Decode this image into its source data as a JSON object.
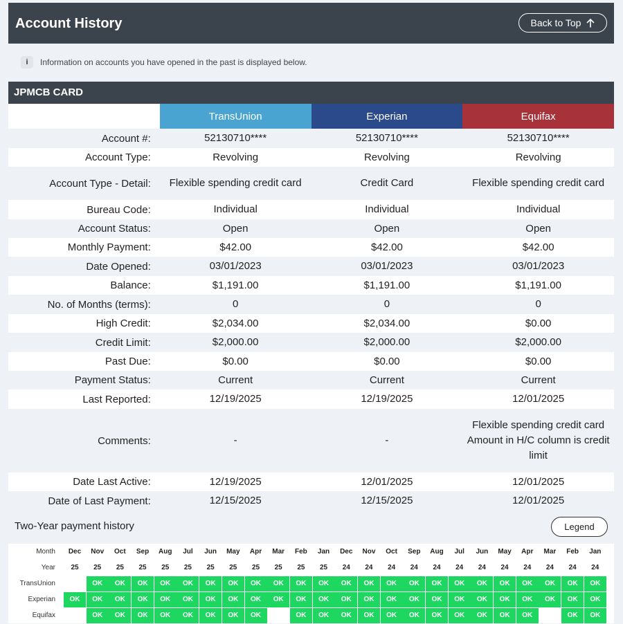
{
  "header": {
    "title": "Account History",
    "back_label": "Back to Top"
  },
  "info_text": "Information on accounts you have opened in the past is displayed below.",
  "account": {
    "name": "JPMCB CARD",
    "bureaus": [
      "TransUnion",
      "Experian",
      "Equifax"
    ],
    "rows": [
      {
        "label": "Account #:",
        "values": [
          "52130710****",
          "52130710****",
          "52130710****"
        ],
        "h": 28
      },
      {
        "label": "Account Type:",
        "values": [
          "Revolving",
          "Revolving",
          "Revolving"
        ],
        "h": 27
      },
      {
        "label": "Account Type - Detail:",
        "values": [
          "Flexible spending credit card",
          "Credit Card",
          "Flexible spending credit card"
        ],
        "h": 48
      },
      {
        "label": "Bureau Code:",
        "values": [
          "Individual",
          "Individual",
          "Individual"
        ],
        "h": 28
      },
      {
        "label": "Account Status:",
        "values": [
          "Open",
          "Open",
          "Open"
        ],
        "h": 27
      },
      {
        "label": "Monthly Payment:",
        "values": [
          "$42.00",
          "$42.00",
          "$42.00"
        ],
        "h": 27
      },
      {
        "label": "Date Opened:",
        "values": [
          "03/01/2023",
          "03/01/2023",
          "03/01/2023"
        ],
        "h": 28
      },
      {
        "label": "Balance:",
        "values": [
          "$1,191.00",
          "$1,191.00",
          "$1,191.00"
        ],
        "h": 27
      },
      {
        "label": "No. of Months (terms):",
        "values": [
          "0",
          "0",
          "0"
        ],
        "h": 28
      },
      {
        "label": "High Credit:",
        "values": [
          "$2,034.00",
          "$2,034.00",
          "$0.00"
        ],
        "h": 27
      },
      {
        "label": "Credit Limit:",
        "values": [
          "$2,000.00",
          "$2,000.00",
          "$2,000.00"
        ],
        "h": 28
      },
      {
        "label": "Past Due:",
        "values": [
          "$0.00",
          "$0.00",
          "$0.00"
        ],
        "h": 27
      },
      {
        "label": "Payment Status:",
        "values": [
          "Current",
          "Current",
          "Current"
        ],
        "h": 27
      },
      {
        "label": "Last Reported:",
        "values": [
          "12/19/2025",
          "12/19/2025",
          "12/01/2025"
        ],
        "h": 28
      },
      {
        "label": "Comments:",
        "values": [
          "-",
          "-",
          "Flexible spending credit card Amount in H/C column is credit limit"
        ],
        "h": 92
      },
      {
        "label": "Date Last Active:",
        "values": [
          "12/19/2025",
          "12/01/2025",
          "12/01/2025"
        ],
        "h": 27
      },
      {
        "label": "Date of Last Payment:",
        "values": [
          "12/15/2025",
          "12/15/2025",
          "12/01/2025"
        ],
        "h": 28
      }
    ]
  },
  "history": {
    "title": "Two-Year payment history",
    "legend_label": "Legend",
    "month_label": "Month",
    "year_label": "Year",
    "months": [
      "Dec",
      "Nov",
      "Oct",
      "Sep",
      "Aug",
      "Jul",
      "Jun",
      "May",
      "Apr",
      "Mar",
      "Feb",
      "Jan",
      "Dec",
      "Nov",
      "Oct",
      "Sep",
      "Aug",
      "Jul",
      "Jun",
      "May",
      "Apr",
      "Mar",
      "Feb",
      "Jan"
    ],
    "years": [
      "25",
      "25",
      "25",
      "25",
      "25",
      "25",
      "25",
      "25",
      "25",
      "25",
      "25",
      "25",
      "24",
      "24",
      "24",
      "24",
      "24",
      "24",
      "24",
      "24",
      "24",
      "24",
      "24",
      "24"
    ],
    "bureaus": [
      {
        "name": "TransUnion",
        "status": [
          "",
          "OK",
          "OK",
          "OK",
          "OK",
          "OK",
          "OK",
          "OK",
          "OK",
          "OK",
          "OK",
          "OK",
          "OK",
          "OK",
          "OK",
          "OK",
          "OK",
          "OK",
          "OK",
          "OK",
          "OK",
          "OK",
          "OK",
          "OK"
        ]
      },
      {
        "name": "Experian",
        "status": [
          "OK",
          "OK",
          "OK",
          "OK",
          "OK",
          "OK",
          "OK",
          "OK",
          "OK",
          "OK",
          "OK",
          "OK",
          "OK",
          "OK",
          "OK",
          "OK",
          "OK",
          "OK",
          "OK",
          "OK",
          "OK",
          "OK",
          "OK",
          "OK"
        ]
      },
      {
        "name": "Equifax",
        "status": [
          "",
          "OK",
          "OK",
          "OK",
          "OK",
          "OK",
          "OK",
          "OK",
          "OK",
          "",
          "OK",
          "OK",
          "OK",
          "OK",
          "OK",
          "OK",
          "OK",
          "OK",
          "OK",
          "OK",
          "OK",
          "",
          "OK",
          "OK"
        ]
      }
    ],
    "ok_color": "#1ed760"
  }
}
